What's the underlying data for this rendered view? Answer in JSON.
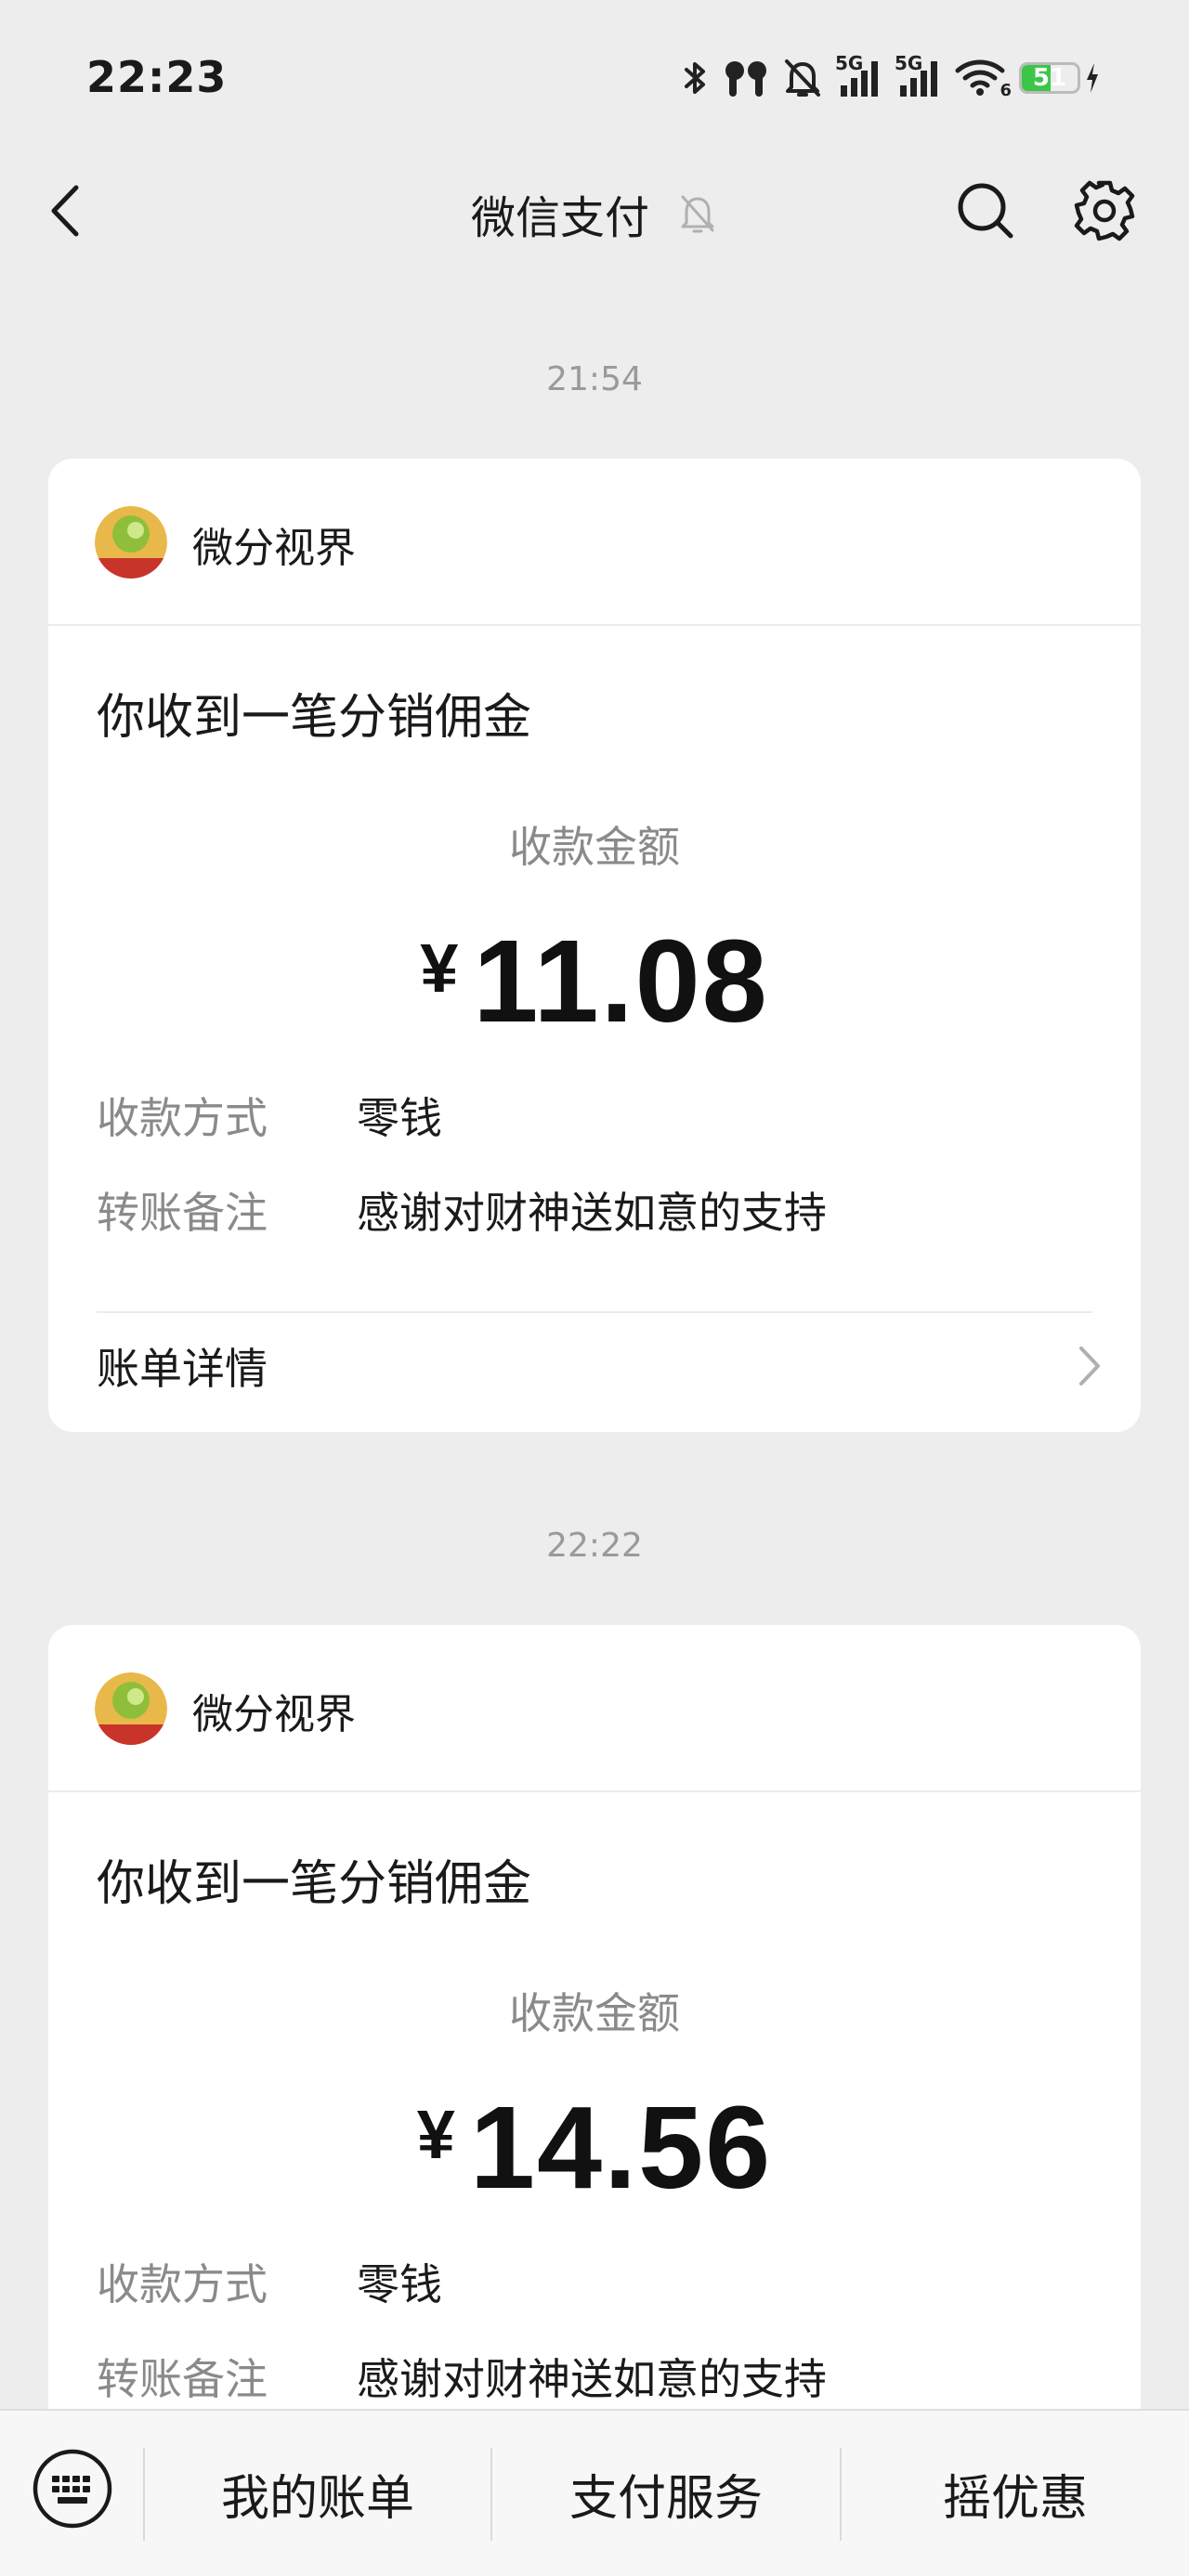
{
  "status_bar": {
    "time": "22:23",
    "net_label_1": "5G",
    "net_label_2": "5G",
    "wifi_label": "6",
    "battery_level": "51",
    "icons": [
      "bluetooth-icon",
      "earbuds-icon",
      "muted-bell-icon",
      "signal-icon",
      "signal-icon",
      "wifi-icon",
      "battery-icon",
      "charging-icon"
    ]
  },
  "nav": {
    "title": "微信支付",
    "icons": [
      "back-arrow-icon",
      "muted-bell-icon",
      "search-icon",
      "gear-icon"
    ]
  },
  "messages": [
    {
      "time": "21:54",
      "merchant": "微分视界",
      "title": "你收到一笔分销佣金",
      "amount_label": "收款金额",
      "currency": "¥",
      "amount": "11.08",
      "method_key": "收款方式",
      "method_value": "零钱",
      "note_key": "转账备注",
      "note_value": "感谢对财神送如意的支持",
      "detail_label": "账单详情"
    },
    {
      "time": "22:22",
      "merchant": "微分视界",
      "title": "你收到一笔分销佣金",
      "amount_label": "收款金额",
      "currency": "¥",
      "amount": "14.56",
      "method_key": "收款方式",
      "method_value": "零钱",
      "note_key": "转账备注",
      "note_value": "感谢对财神送如意的支持"
    }
  ],
  "bottom_menu": {
    "items": [
      "我的账单",
      "支付服务",
      "摇优惠"
    ]
  },
  "colors": {
    "background": "#ededed",
    "card": "#ffffff",
    "muted_text": "#8a8a8a",
    "battery": "#3cc649"
  }
}
